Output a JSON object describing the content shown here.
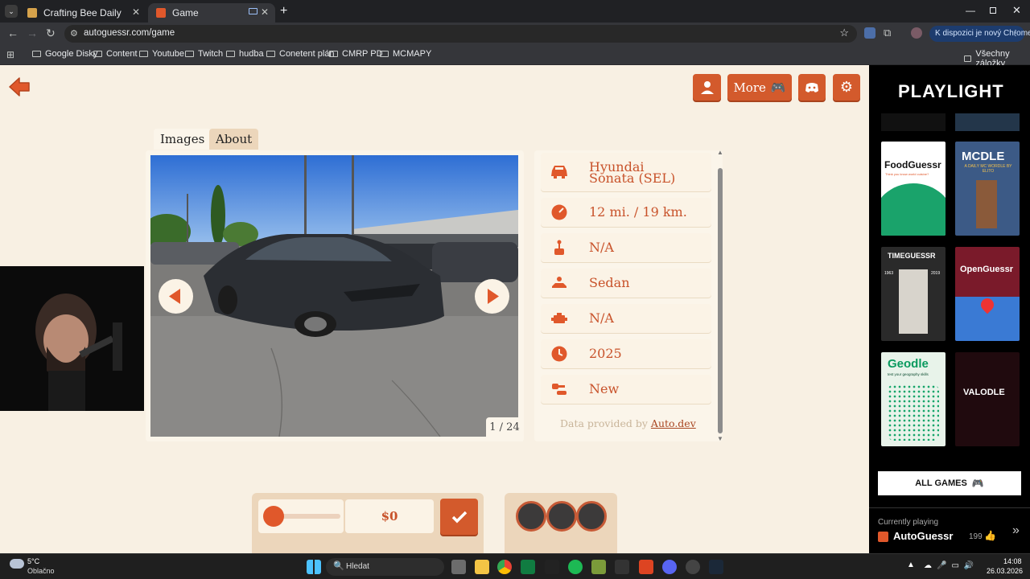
{
  "browser": {
    "tabs": [
      {
        "title": "Crafting Bee Daily",
        "active": false
      },
      {
        "title": "Game",
        "active": true
      }
    ],
    "url": "autoguessr.com/game",
    "update_label": "K dispozici je nový Chrome",
    "bookmarks": [
      "Google Disky",
      "Content",
      "Youtube",
      "Twitch",
      "hudba",
      "Conetent plán",
      "CMRP PD",
      "MCMAPY"
    ],
    "all_bookmarks": "Všechny záložky"
  },
  "game": {
    "header": {
      "more_label": "More"
    },
    "tabs": [
      "Images",
      "About"
    ],
    "image_counter": "1 / 24",
    "car_info": {
      "model": [
        "Hyundai",
        "Sonata (SEL)"
      ],
      "mileage": "12 mi. / 19 km.",
      "transmission": "N/A",
      "body": "Sedan",
      "engine": "N/A",
      "year": "2025",
      "condition": "New"
    },
    "data_credit": {
      "prefix": "Data provided by",
      "link": "Auto.dev"
    },
    "guess": {
      "price": "$0",
      "slider_level": 0
    }
  },
  "sidebar": {
    "brand": "PLAYLIGHT",
    "all_games_label": "ALL GAMES",
    "currently_playing_label": "Currently playing",
    "current_game": "AutoGuessr",
    "likes": "199",
    "game_cards": [
      {
        "title": "FoodGuessr",
        "subtitle": "Think you know world cuisine?"
      },
      {
        "title": "MCDLE",
        "subtitle": "A DAILY MC WORDLE BY ELITO"
      },
      {
        "title": "TIMEGUESSR",
        "years": [
          "1963",
          "2019"
        ]
      },
      {
        "title": "OpenGuessr"
      },
      {
        "title": "Geodle",
        "subtitle": "test your geography skills"
      },
      {
        "title": "VALODLE"
      }
    ]
  },
  "taskbar": {
    "weather_temp": "5°C",
    "weather_desc": "Oblačno",
    "search_placeholder": "Hledat",
    "time": "14:08",
    "date": "26.03.2026"
  },
  "colors": {
    "accent": "#d35a2c",
    "page_bg": "#f8f0e3",
    "text_accent": "#c8522a"
  }
}
